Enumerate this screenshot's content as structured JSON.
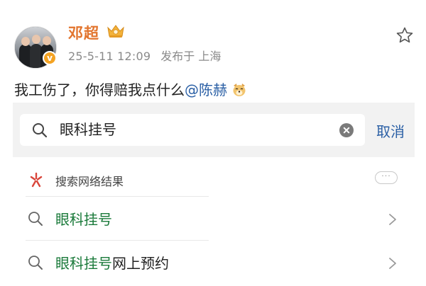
{
  "post": {
    "username": "邓超",
    "time": "25-5-11 12:09",
    "source": "发布于 上海",
    "text_before": "我工伤了，你得赔我点什么",
    "mention": "@陈赫",
    "verified_mark": "v"
  },
  "search": {
    "query": "眼科挂号",
    "cancel_label": "取消"
  },
  "web_results": {
    "label": "搜索网络结果",
    "more": "···"
  },
  "results": [
    {
      "highlight": "眼科挂号",
      "rest": ""
    },
    {
      "highlight": "眼科挂号",
      "rest": "网上预约"
    }
  ],
  "colors": {
    "username": "#e2742d",
    "link": "#2a5fa5",
    "highlight": "#1a7a3a",
    "meta": "#8a8a8a"
  },
  "icons": [
    "vip-crown-icon",
    "star-icon",
    "dog-emoji-icon",
    "search-icon",
    "clear-icon",
    "web-spark-icon",
    "more-icon",
    "chevron-right-icon"
  ]
}
